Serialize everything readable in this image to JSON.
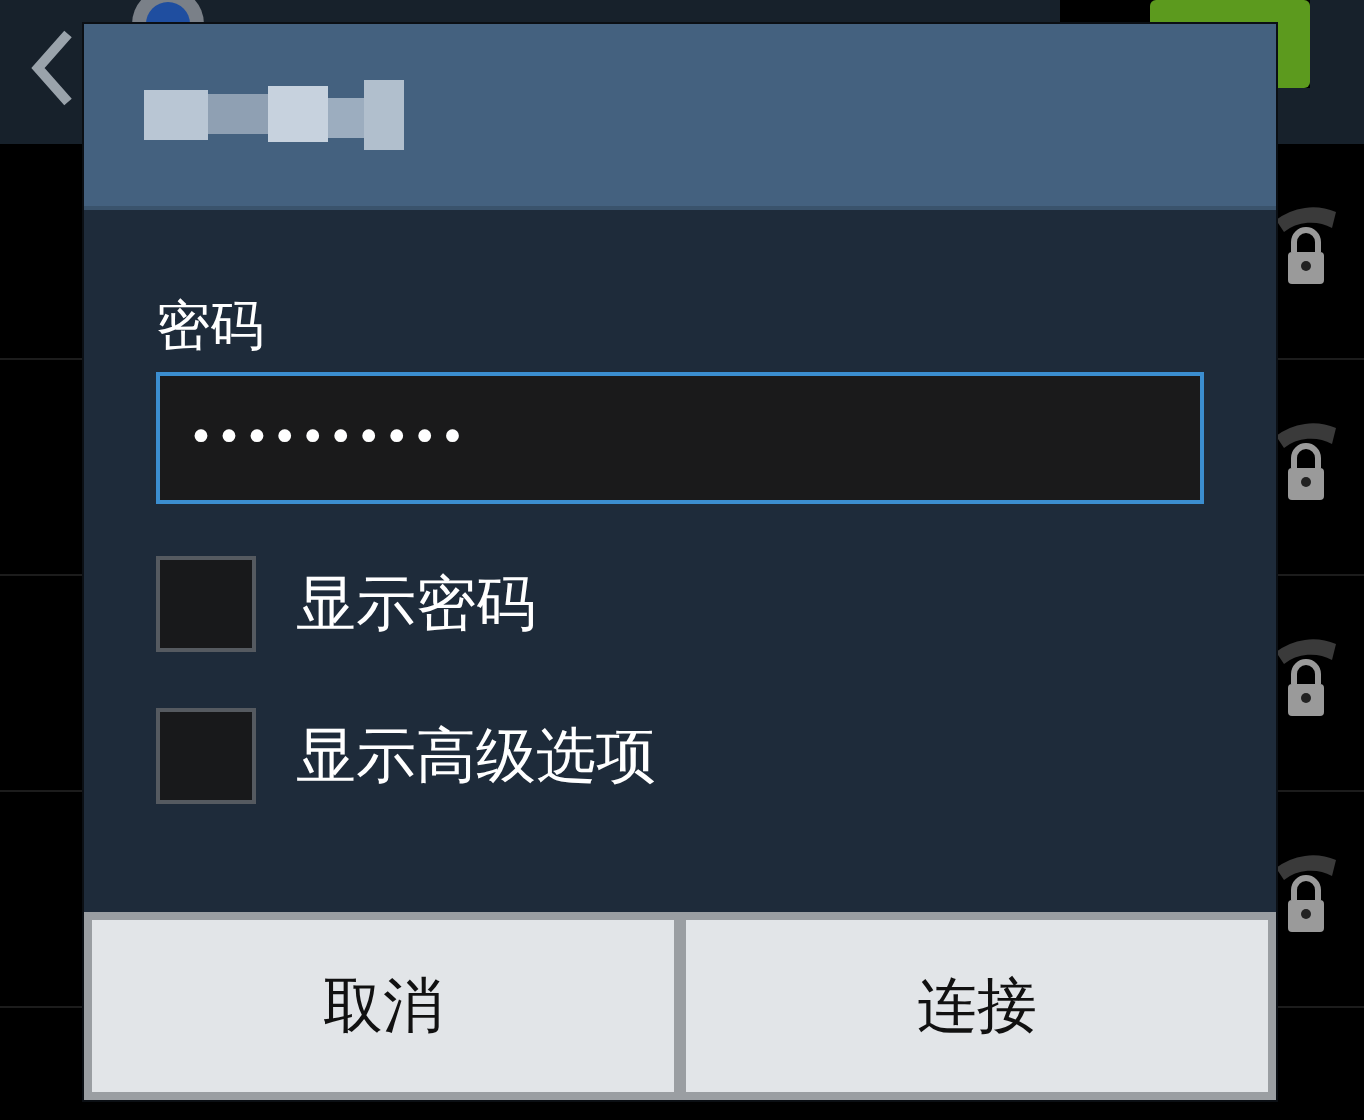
{
  "dialog": {
    "password": {
      "label": "密码",
      "value": "••••••••••"
    },
    "options": [
      {
        "label": "显示密码",
        "checked": false
      },
      {
        "label": "显示高级选项",
        "checked": false
      }
    ],
    "buttons": [
      "取消",
      "连接"
    ]
  },
  "networks": [
    {
      "secured": true
    },
    {
      "secured": true
    },
    {
      "secured": true
    },
    {
      "secured": true
    }
  ]
}
